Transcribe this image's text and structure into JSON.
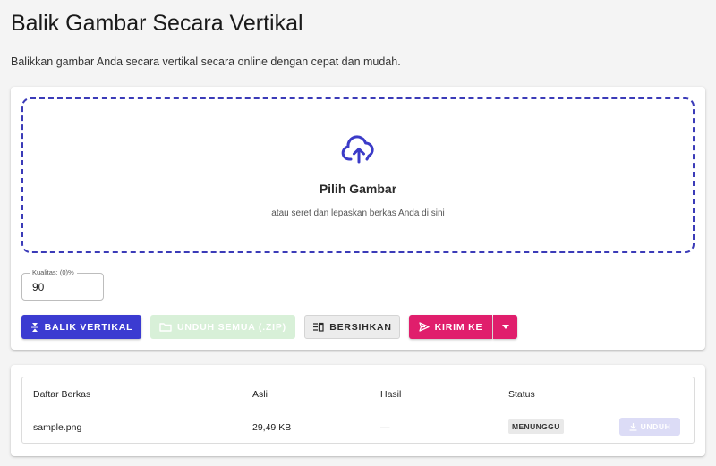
{
  "header": {
    "title": "Balik Gambar Secara Vertikal",
    "description": "Balikkan gambar Anda secara vertikal secara online dengan cepat dan mudah."
  },
  "dropzone": {
    "icon": "cloud-upload-icon",
    "title": "Pilih Gambar",
    "hint": "atau seret dan lepaskan berkas Anda di sini"
  },
  "quality": {
    "label": "Kualitas: (0)%",
    "value": "90"
  },
  "toolbar": {
    "flip_label": "BALIK VERTIKAL",
    "zip_label": "UNDUH SEMUA (.ZIP)",
    "clear_label": "BERSIHKAN",
    "send_label": "KIRIM KE"
  },
  "colors": {
    "primary": "#3b3bd1",
    "dropzone_border": "#3b3bb8",
    "send_accent": "#e01e6c",
    "zip_disabled": "#d8f0d8"
  },
  "files_table": {
    "headers": [
      "Daftar Berkas",
      "Asli",
      "Hasil",
      "Status"
    ],
    "rows": [
      {
        "name": "sample.png",
        "original": "29,49 KB",
        "result": "—",
        "status": "MENUNGGU",
        "action": "UNDUH"
      }
    ]
  }
}
